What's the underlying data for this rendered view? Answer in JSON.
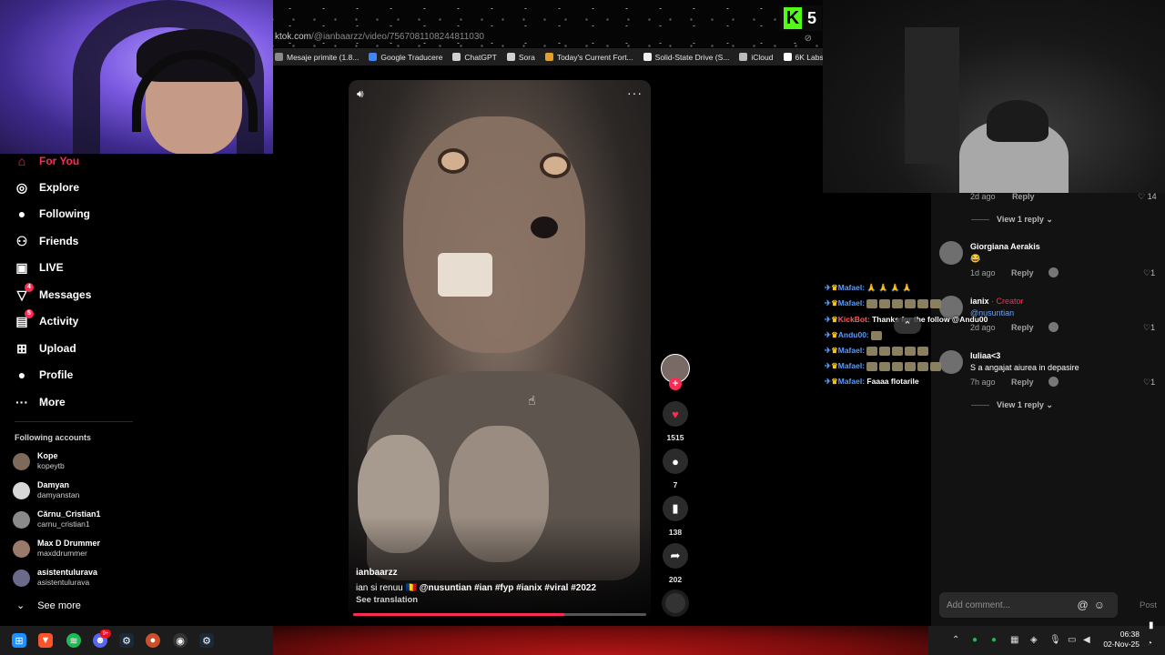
{
  "browser": {
    "url_host": "ktok.com",
    "url_path": "/@ianbaarzz/video/7567081108244811030",
    "bookmarks": [
      {
        "label": "Mesaje primite (1.8...",
        "color": "#8a8a8a"
      },
      {
        "label": "Google Traducere",
        "color": "#4285f4"
      },
      {
        "label": "ChatGPT",
        "color": "#d0d0d0"
      },
      {
        "label": "Sora",
        "color": "#d0d0d0"
      },
      {
        "label": "Today's Current Fort...",
        "color": "#e0a030"
      },
      {
        "label": "Solid-State Drive (S...",
        "color": "#f0f0f0"
      },
      {
        "label": "iCloud",
        "color": "#bbbbbb"
      },
      {
        "label": "6K Labs",
        "color": "#ffffff"
      }
    ]
  },
  "kick_badge": {
    "letter": "K",
    "count": "5",
    "color": "#53fc18"
  },
  "sidebar": {
    "nav": [
      {
        "label": "For You",
        "icon": "home-icon",
        "glyph": "⌂",
        "active": true
      },
      {
        "label": "Explore",
        "icon": "compass-icon",
        "glyph": "◎"
      },
      {
        "label": "Following",
        "icon": "following-avatar-icon",
        "glyph": "●"
      },
      {
        "label": "Friends",
        "icon": "friends-icon",
        "glyph": "⚇"
      },
      {
        "label": "LIVE",
        "icon": "live-tv-icon",
        "glyph": "▣"
      },
      {
        "label": "Messages",
        "icon": "messages-icon",
        "glyph": "▽",
        "badge": "4"
      },
      {
        "label": "Activity",
        "icon": "activity-icon",
        "glyph": "▤",
        "badge": "5"
      },
      {
        "label": "Upload",
        "icon": "upload-icon",
        "glyph": "⊞"
      },
      {
        "label": "Profile",
        "icon": "profile-avatar-icon",
        "glyph": "●"
      },
      {
        "label": "More",
        "icon": "more-icon",
        "glyph": "···"
      }
    ],
    "following_title": "Following accounts",
    "accounts": [
      {
        "name": "Kope",
        "username": "kopeytb"
      },
      {
        "name": "Damyan",
        "username": "damyanstan"
      },
      {
        "name": "Cărnu_Cristian1",
        "username": "carnu_cristian1"
      },
      {
        "name": "Max D Drummer",
        "username": "maxddrummer"
      },
      {
        "name": "asistentulurava",
        "username": "asistentulurava"
      }
    ],
    "see_more": "See more"
  },
  "video": {
    "author": "ianbaarzz",
    "caption_text": "ian si renuu",
    "caption_mention": "@nusuntian",
    "hashtags": "#ian  #fyp  #ianix  #viral  #2022",
    "see_translation": "See translation",
    "progress": 0.72,
    "likes": "1515",
    "comments": "7",
    "saves": "138",
    "shares": "202"
  },
  "comments_panel": {
    "top_meta": {
      "time": "2d ago",
      "reply": "Reply",
      "likes": "14"
    },
    "view_reply": "View 1 reply",
    "items": [
      {
        "name": "Giorgiana Aerakis",
        "text": "😂",
        "time": "1d ago",
        "reply": "Reply",
        "likes": "1"
      },
      {
        "name": "ianix",
        "badge": "· Creator",
        "text": "@nusuntian",
        "time": "2d ago",
        "reply": "Reply",
        "likes": "1"
      },
      {
        "name": "Iuliaa<3",
        "text": "S a angajat aiurea in depasire",
        "time": "7h ago",
        "reply": "Reply",
        "likes": "1"
      }
    ],
    "view_reply_2": "View 1 reply",
    "add_placeholder": "Add comment...",
    "post": "Post"
  },
  "chat": [
    {
      "user": "Mafael:",
      "text": "🙏 🙏 🙏 🙏"
    },
    {
      "user": "Mafael:",
      "text": ""
    },
    {
      "user": "KickBot:",
      "text": "Thanks for the follow @Andu00",
      "bot": true
    },
    {
      "user": "Andu00:",
      "text": ""
    },
    {
      "user": "Mafael:",
      "text": ""
    },
    {
      "user": "Mafael:",
      "text": ""
    },
    {
      "user": "Mafael:",
      "text": "Faaaa flotarile"
    }
  ],
  "taskbar": {
    "time": "06:38",
    "date": "02-Nov-25",
    "discord_badge": "9+"
  }
}
